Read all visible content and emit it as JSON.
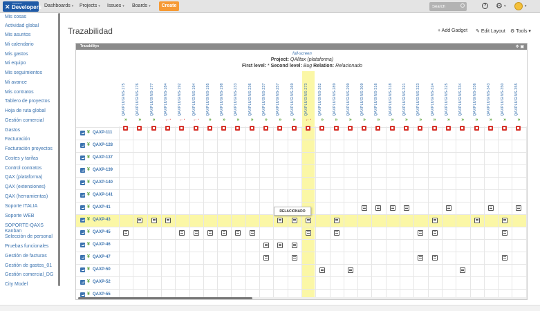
{
  "logo": {
    "small": "Atlassian",
    "main": "Developers"
  },
  "nav": [
    {
      "label": "Dashboards",
      "caret": "▾"
    },
    {
      "label": "Projects",
      "caret": "▾"
    },
    {
      "label": "Issues",
      "caret": "▾"
    },
    {
      "label": "Boards",
      "caret": "▾"
    }
  ],
  "create_label": "Create",
  "search": {
    "placeholder": "Search"
  },
  "sidebar": [
    "Mis cosas",
    "Actividad global",
    "Mis asuntos",
    "Mi calendario",
    "Mis gastos",
    "Mi equipo",
    "Mis seguimientos",
    "Mi avance",
    "Mis contratos",
    "Tablero de proyectos",
    "Hoja de ruta global",
    "Gestión comercial",
    "Gastos",
    "Facturación",
    "Facturación proyectos",
    "Costes y tarifas",
    "Control contratos",
    "QAX (plataforma)",
    "QAX (extensiones)",
    "QAX (herramientas)",
    "Soporte ITALIA",
    "Soporte WEB",
    "SOPORTE-QAXS Kanban",
    "Selección de personal",
    "Pruebas funcionales",
    "Gestión de facturas",
    "Gestión de gastos_01",
    "Gestión comercial_DG",
    "City Model"
  ],
  "page": {
    "title": "Trazabilidad",
    "add_gadget": "Add Gadget",
    "edit_layout": "Edit Layout",
    "tools": "Tools"
  },
  "gadget": {
    "title": "Trazabilitys",
    "fullscreen": "full-screen",
    "project_label": "Project:",
    "project_value": "QAlltax (plataforma)",
    "first_level_label": "First level:",
    "first_level_value": "*",
    "second_level_label": "Second level:",
    "second_level_value": "Bug",
    "relation_label": "Relation:",
    "relation_value": "Relacionado",
    "tooltip": "RELACIONADO"
  },
  "columns": [
    {
      "key": "QAXPLUGINS-175",
      "dir": "in"
    },
    {
      "key": "QAXPLUGINS-176",
      "dir": "in"
    },
    {
      "key": "QAXPLUGINS-177",
      "dir": "in"
    },
    {
      "key": "QAXPLUGINS-184",
      "dir": "out"
    },
    {
      "key": "QAXPLUGINS-192",
      "dir": "out"
    },
    {
      "key": "QAXPLUGINS-194",
      "dir": "out"
    },
    {
      "key": "QAXPLUGINS-195",
      "dir": "in"
    },
    {
      "key": "QAXPLUGINS-198",
      "dir": "in"
    },
    {
      "key": "QAXPLUGINS-233",
      "dir": "in"
    },
    {
      "key": "QAXPLUGINS-236",
      "dir": "in"
    },
    {
      "key": "QAXPLUGINS-237",
      "dir": "in"
    },
    {
      "key": "QAXPLUGINS-257",
      "dir": "in"
    },
    {
      "key": "QAXPLUGINS-269",
      "dir": "in"
    },
    {
      "key": "QAXPLUGINS-273",
      "dir": "out"
    },
    {
      "key": "QAXPLUGINS-282",
      "dir": "in"
    },
    {
      "key": "QAXPLUGINS-289",
      "dir": "in"
    },
    {
      "key": "QAXPLUGINS-299",
      "dir": "in"
    },
    {
      "key": "QAXPLUGINS-309",
      "dir": "in"
    },
    {
      "key": "QAXPLUGINS-316",
      "dir": "in"
    },
    {
      "key": "QAXPLUGINS-318",
      "dir": "in"
    },
    {
      "key": "QAXPLUGINS-321",
      "dir": "in"
    },
    {
      "key": "QAXPLUGINS-323",
      "dir": "in"
    },
    {
      "key": "QAXPLUGINS-324",
      "dir": "in"
    },
    {
      "key": "QAXPLUGINS-325",
      "dir": "in"
    },
    {
      "key": "QAXPLUGINS-334",
      "dir": "in"
    },
    {
      "key": "QAXPLUGINS-336",
      "dir": "in"
    },
    {
      "key": "QAXPLUGINS-343",
      "dir": "in"
    },
    {
      "key": "QAXPLUGINS-350",
      "dir": "in"
    },
    {
      "key": "QAXPLUGINS-355",
      "dir": "in"
    },
    {
      "key": "QAXPLUGINS-356",
      "dir": "in"
    }
  ],
  "highlight": {
    "column_index": 13,
    "row_index": 8
  },
  "rows": [
    {
      "key": "QAXP-111",
      "cells": []
    },
    {
      "key": "QAXP-128",
      "cells": []
    },
    {
      "key": "QAXP-137",
      "cells": []
    },
    {
      "key": "QAXP-139",
      "cells": []
    },
    {
      "key": "QAXP-140",
      "cells": []
    },
    {
      "key": "QAXP-141",
      "cells": []
    },
    {
      "key": "QAXP-41",
      "cells": [
        17,
        18,
        19,
        20,
        23,
        26,
        28,
        29
      ]
    },
    {
      "key": "QAXP-43",
      "cells": [
        1,
        2,
        3,
        11,
        12,
        13,
        15,
        22,
        25,
        27
      ]
    },
    {
      "key": "QAXP-45",
      "cells": [
        0,
        4,
        5,
        6,
        7,
        8,
        9,
        13,
        15,
        21,
        22,
        27
      ]
    },
    {
      "key": "QAXP-46",
      "cells": [
        10,
        11,
        12,
        29
      ]
    },
    {
      "key": "QAXP-47",
      "cells": [
        10,
        12,
        21,
        22,
        27
      ]
    },
    {
      "key": "QAXP-50",
      "cells": [
        14,
        16,
        24
      ]
    },
    {
      "key": "QAXP-52",
      "cells": []
    },
    {
      "key": "QAXP-55",
      "cells": []
    }
  ],
  "colors": {
    "accent": "#3b73af",
    "create": "#f69a35",
    "highlight": "#fbf7a6",
    "in_arrow": "#5aa23a",
    "out_arrow": "#d6332b"
  },
  "icons": {
    "arrow_in": "»",
    "arrow_out": "←·",
    "row_marker": "¥"
  }
}
